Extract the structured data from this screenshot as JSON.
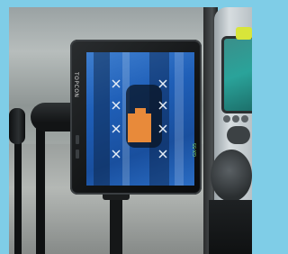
{
  "monitor": {
    "brand_label": "TOPCON",
    "model_label": "GX-55",
    "screen_color": "#1f5fb8",
    "target_color": "#e88a3a"
  },
  "colors": {
    "sky_frame": "#7fcde7",
    "ground": "#8a8f8c",
    "cab_panel": "#cfd6da",
    "display_teal": "#2aa39a"
  },
  "icons": [
    "target-crosshair-icon",
    "target-crosshair-icon",
    "target-crosshair-icon",
    "target-crosshair-icon",
    "target-crosshair-icon",
    "target-crosshair-icon",
    "target-crosshair-icon",
    "target-crosshair-icon"
  ]
}
